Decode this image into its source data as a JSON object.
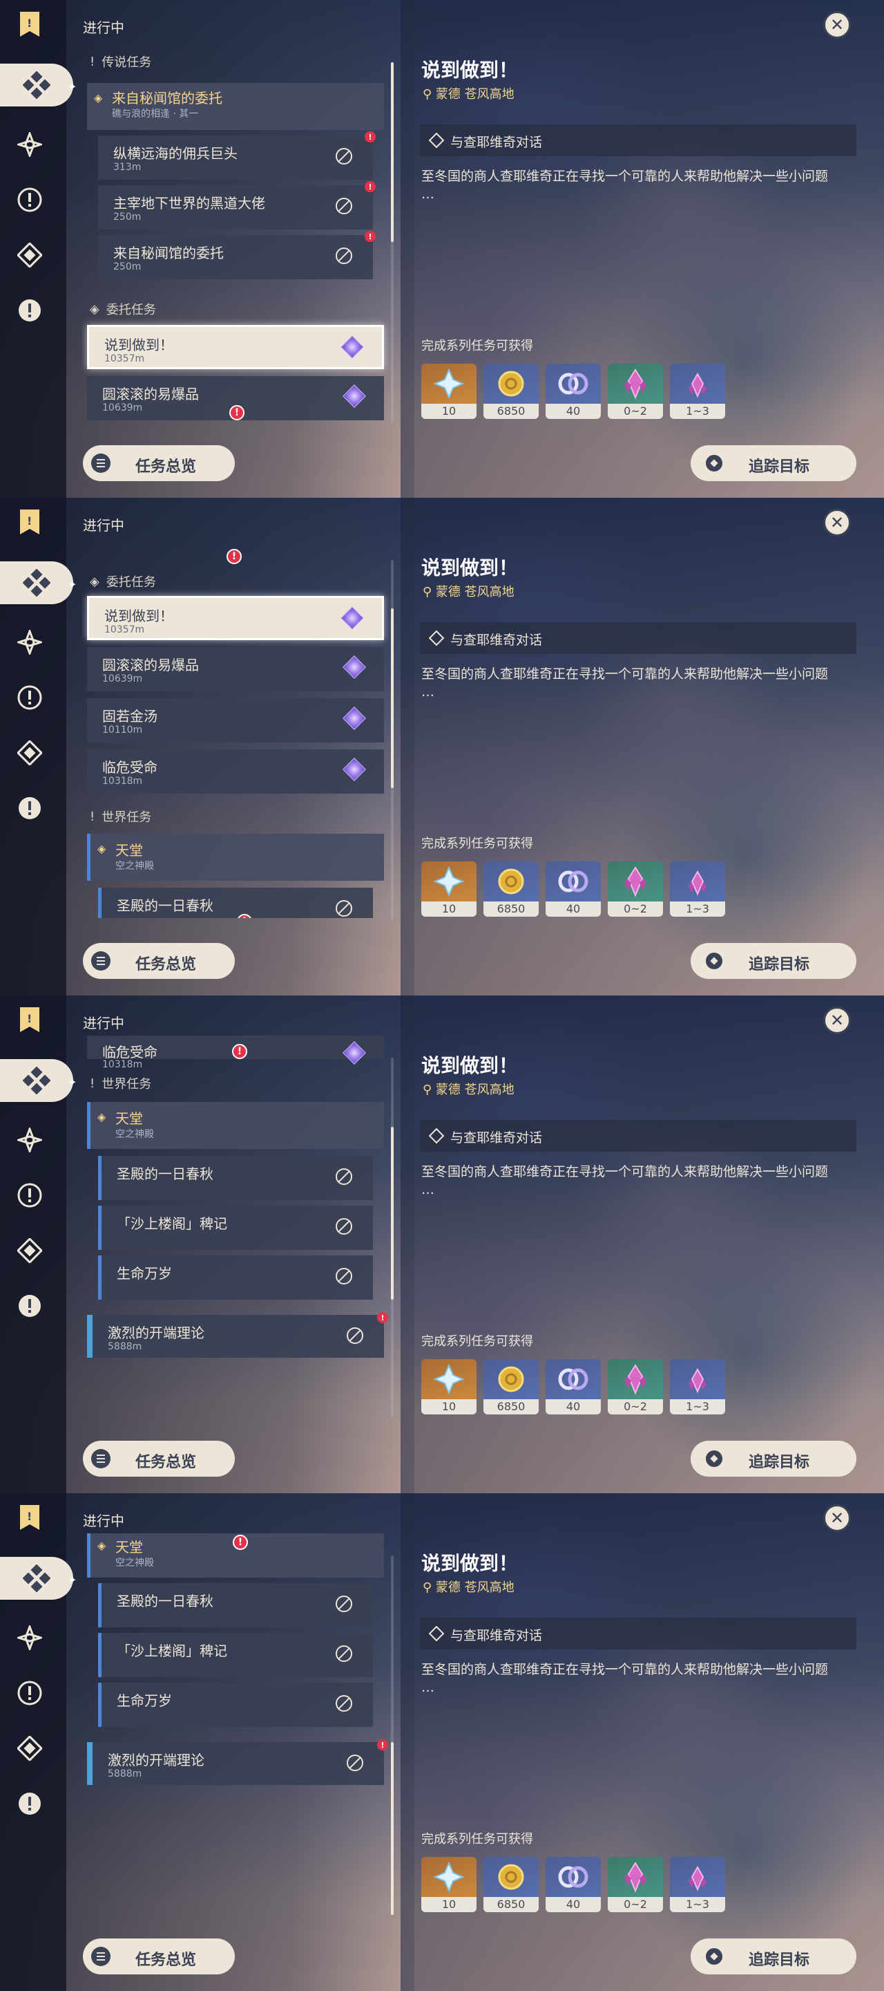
{
  "panels_count": 4,
  "header": {
    "title": "进行中",
    "close_icon": "close-icon"
  },
  "categories": {
    "legend": "传说任务",
    "commission": "委托任务",
    "world": "世界任务"
  },
  "legend_group": {
    "title": "来自秘闻馆的委托",
    "subtitle": "礁与浪的相逢 · 其一"
  },
  "legend_quests": [
    {
      "title": "纵横远海的佣兵巨头",
      "distance": "313m"
    },
    {
      "title": "主宰地下世界的黑道大佬",
      "distance": "250m"
    },
    {
      "title": "来自秘闻馆的委托",
      "distance": "250m"
    }
  ],
  "commissions": [
    {
      "title": "说到做到！",
      "distance": "10357m"
    },
    {
      "title": "圆滚滚的易爆品",
      "distance": "10639m"
    },
    {
      "title": "固若金汤",
      "distance": "10110m"
    },
    {
      "title": "临危受命",
      "distance": "10318m"
    }
  ],
  "world_group": {
    "title": "天堂",
    "subtitle": "空之神殿"
  },
  "world_quests": [
    {
      "title": "圣殿的一日春秋"
    },
    {
      "title": "「沙上楼阁」稗记"
    },
    {
      "title": "生命万岁"
    }
  ],
  "standalone_quest": {
    "title": "激烈的开端理论",
    "distance": "5888m"
  },
  "detail": {
    "title": "说到做到！",
    "location": "蒙德 苍风高地",
    "step": "与查耶维奇对话",
    "description": "至冬国的商人查耶维奇正在寻找一个可靠的人来帮助他解决一些小问题\n…",
    "rewards_title": "完成系列任务可获得",
    "rewards": [
      {
        "icon": "primogem-icon",
        "qty": "10"
      },
      {
        "icon": "mora-icon",
        "qty": "6850"
      },
      {
        "icon": "fate-icon",
        "qty": "40"
      },
      {
        "icon": "crystal-icon",
        "qty": "0~2"
      },
      {
        "icon": "crystal-small-icon",
        "qty": "1~3"
      }
    ]
  },
  "buttons": {
    "overview": "任务总览",
    "track": "追踪目标"
  },
  "alert_mark": "!"
}
